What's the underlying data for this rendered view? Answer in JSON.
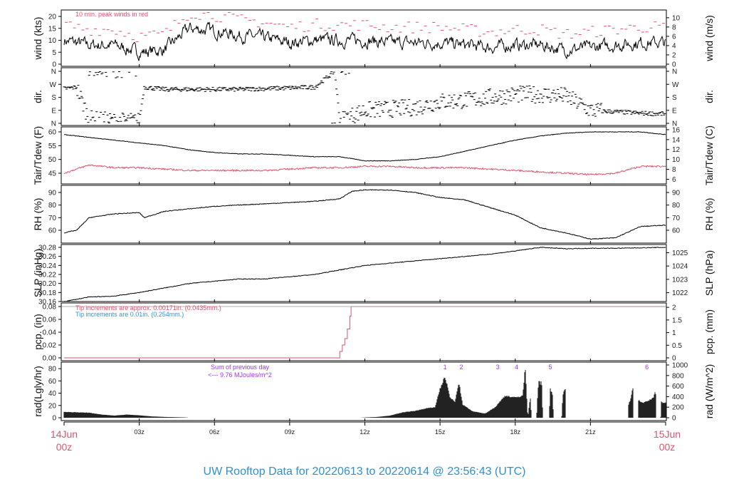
{
  "title": "UW Rooftop Data for 20220613  to  20220614 @ 23:56:43  (UTC)",
  "colors": {
    "red": "#df536b",
    "blue": "#2297e6",
    "purple": "#a033ee",
    "title": "#2d8fd5",
    "line": "#000000"
  },
  "x_axis": {
    "start_label": [
      "14Jun",
      "00z"
    ],
    "end_label": [
      "15Jun",
      "00z"
    ],
    "ticks": [
      {
        "h": 3,
        "label": "03z"
      },
      {
        "h": 6,
        "label": "06z"
      },
      {
        "h": 9,
        "label": "09z"
      },
      {
        "h": 12,
        "label": "12z"
      },
      {
        "h": 15,
        "label": "15z"
      },
      {
        "h": 18,
        "label": "18z"
      },
      {
        "h": 21,
        "label": "21z"
      }
    ]
  },
  "chart_data": [
    {
      "id": "wind",
      "type": "line",
      "ylabel": "wind (kts)",
      "ylabel_right": "wind (m/s)",
      "annotation": "10 min. peak winds in red",
      "left_ticks": [
        "0",
        "5",
        "10",
        "15",
        "20"
      ],
      "right_ticks": [
        "0",
        "2",
        "4",
        "6",
        "8",
        "10"
      ],
      "hours": [
        0,
        1,
        2,
        3,
        4,
        5,
        6,
        7,
        8,
        9,
        10,
        11,
        12,
        13,
        14,
        15,
        16,
        17,
        18,
        19,
        20,
        21,
        22,
        23,
        24
      ],
      "values": [
        10,
        8,
        8,
        5,
        6,
        15,
        14,
        12,
        11,
        9,
        10,
        10,
        10,
        9,
        9,
        9,
        8,
        7,
        8,
        8,
        6,
        7,
        8,
        9,
        9
      ]
    },
    {
      "id": "dir",
      "type": "scatter",
      "ylabel": "dir.",
      "ylabel_right": "dir.",
      "left_ticks": [
        "N",
        "E",
        "S",
        "W",
        "N"
      ],
      "right_ticks": [
        "N",
        "E",
        "S",
        "W",
        "N"
      ],
      "hours": [
        0,
        0.5,
        1,
        2,
        3,
        3.2,
        4,
        5,
        6,
        7,
        8,
        9,
        10,
        10.8,
        11,
        12,
        13,
        14,
        15,
        16,
        17,
        18,
        19,
        20,
        21,
        22,
        23,
        24
      ],
      "values": [
        240,
        250,
        30,
        15,
        15,
        250,
        235,
        235,
        235,
        235,
        240,
        245,
        250,
        360,
        20,
        90,
        100,
        110,
        150,
        160,
        180,
        200,
        200,
        190,
        90,
        80,
        70,
        65
      ]
    },
    {
      "id": "temp",
      "type": "line",
      "ylabel": "Tair/Tdew (F)",
      "ylabel_right": "Tair/Tdew (C)",
      "left_ticks": [
        "45",
        "50",
        "55",
        "60"
      ],
      "right_ticks": [
        "6",
        "8",
        "10",
        "12",
        "14",
        "16"
      ],
      "hours": [
        0,
        1,
        2,
        3,
        4,
        5,
        6,
        7,
        8,
        9,
        10,
        11,
        12,
        13,
        14,
        15,
        16,
        17,
        18,
        19,
        20,
        21,
        22,
        23,
        24
      ],
      "series": [
        {
          "name": "Tair",
          "values": [
            59,
            58,
            57,
            56,
            55,
            53.5,
            52.5,
            52,
            52,
            51.5,
            51,
            51,
            49.5,
            49.5,
            50,
            51,
            53,
            55,
            57,
            58.5,
            59.5,
            60,
            60,
            60,
            59
          ]
        },
        {
          "name": "Tdew",
          "values": [
            45,
            48,
            47,
            47,
            46.5,
            46,
            46,
            46,
            46,
            46.5,
            47,
            47,
            47.5,
            47.5,
            47,
            47,
            47,
            46.5,
            46,
            45.5,
            45,
            44.5,
            45,
            47.5,
            47.5
          ]
        }
      ]
    },
    {
      "id": "rh",
      "type": "line",
      "ylabel": "RH (%)",
      "ylabel_right": "RH (%)",
      "left_ticks": [
        "60",
        "70",
        "80",
        "90"
      ],
      "right_ticks": [
        "60",
        "70",
        "80",
        "90"
      ],
      "hours": [
        0,
        0.5,
        1,
        2,
        3,
        3.2,
        4,
        5,
        6,
        7,
        8,
        9,
        10,
        11,
        11.5,
        12,
        13,
        14,
        15,
        16,
        17,
        18,
        19,
        20,
        21,
        22,
        23,
        24
      ],
      "values": [
        58,
        60,
        70,
        73,
        74,
        70,
        75,
        77,
        79,
        80,
        81,
        82,
        83,
        85,
        91,
        92,
        92,
        90,
        86,
        84,
        78,
        72,
        62,
        58,
        53,
        54,
        63,
        64
      ]
    },
    {
      "id": "slp",
      "type": "line",
      "ylabel": "SLP (inHg)",
      "ylabel_right": "SLP (hPa)",
      "left_ticks": [
        "30.16",
        "30.18",
        "30.20",
        "30.22",
        "30.24",
        "30.26",
        "30.28"
      ],
      "right_ticks": [
        "1022",
        "1023",
        "1024",
        "1025"
      ],
      "hours": [
        0,
        1,
        2,
        3,
        4,
        5,
        6,
        7,
        8,
        9,
        10,
        11,
        12,
        13,
        14,
        15,
        16,
        17,
        18,
        19,
        20,
        21,
        22,
        23,
        24
      ],
      "values": [
        30.16,
        30.17,
        30.172,
        30.18,
        30.19,
        30.2,
        30.205,
        30.21,
        30.21,
        30.215,
        30.22,
        30.23,
        30.24,
        30.245,
        30.25,
        30.255,
        30.26,
        30.265,
        30.272,
        30.28,
        30.277,
        30.278,
        30.278,
        30.279,
        30.28
      ]
    },
    {
      "id": "pcp",
      "type": "line",
      "ylabel": "pcp. (in)",
      "ylabel_right": "pcp. (mm)",
      "note_red": "Tip increments are approx. 0.00171in. (0.0435mm.)",
      "note_blue": "Tip increments are 0.01in. (0.254mm.)",
      "left_ticks": [
        "0.00",
        "0.02",
        "0.04",
        "0.06",
        "0.08"
      ],
      "right_ticks": [
        "0",
        "0.5",
        "1",
        "1.5",
        "2"
      ],
      "hours": [
        0,
        10.9,
        11.0,
        11.1,
        11.2,
        11.3,
        11.4,
        11.45,
        24
      ],
      "values": [
        0,
        0,
        0.01,
        0.02,
        0.03,
        0.045,
        0.065,
        0.08,
        0.08
      ]
    },
    {
      "id": "rad",
      "type": "area",
      "ylabel": "rad(Lgly/hr)",
      "ylabel_right": "rad (W/m^2)",
      "note": "Sum of previous day",
      "note2": "<--- 9.76 MJoules/m^2",
      "left_ticks": [
        "0",
        "20",
        "40",
        "60",
        "80"
      ],
      "right_ticks": [
        "0",
        "200",
        "400",
        "600",
        "800",
        "1000"
      ],
      "markers": [
        {
          "h": 15.2,
          "label": "1"
        },
        {
          "h": 15.85,
          "label": "2"
        },
        {
          "h": 17.3,
          "label": "3"
        },
        {
          "h": 18.05,
          "label": "4"
        },
        {
          "h": 19.4,
          "label": "5"
        },
        {
          "h": 23.25,
          "label": "6"
        }
      ],
      "points": [
        [
          0,
          110
        ],
        [
          1,
          95
        ],
        [
          1.5,
          60
        ],
        [
          2,
          40
        ],
        [
          2.5,
          60
        ],
        [
          3,
          45
        ],
        [
          3.5,
          25
        ],
        [
          4,
          15
        ],
        [
          4.5,
          10
        ],
        [
          4.9,
          5
        ],
        [
          4.95,
          0
        ],
        [
          11.8,
          0
        ],
        [
          12,
          5
        ],
        [
          12.5,
          15
        ],
        [
          13,
          40
        ],
        [
          13.5,
          100
        ],
        [
          14,
          130
        ],
        [
          14.5,
          180
        ],
        [
          14.8,
          200
        ],
        [
          15.0,
          550
        ],
        [
          15.2,
          780
        ],
        [
          15.4,
          380
        ],
        [
          15.6,
          300
        ],
        [
          15.75,
          680
        ],
        [
          15.9,
          250
        ],
        [
          16.3,
          120
        ],
        [
          16.8,
          80
        ],
        [
          17.2,
          200
        ],
        [
          17.6,
          420
        ],
        [
          18,
          380
        ],
        [
          18.3,
          420
        ],
        [
          18.4,
          960
        ],
        [
          18.5,
          0
        ],
        [
          18.6,
          400
        ],
        [
          18.65,
          0
        ],
        [
          18.85,
          0
        ],
        [
          18.9,
          500
        ],
        [
          18.95,
          750
        ],
        [
          19.0,
          600
        ],
        [
          19.05,
          720
        ],
        [
          19.1,
          0
        ],
        [
          19.35,
          0
        ],
        [
          19.4,
          550
        ],
        [
          19.5,
          420
        ],
        [
          19.52,
          0
        ],
        [
          19.85,
          0
        ],
        [
          19.9,
          450
        ],
        [
          20.0,
          560
        ],
        [
          20.02,
          0
        ],
        [
          22.5,
          0
        ],
        [
          22.52,
          250
        ],
        [
          22.6,
          350
        ],
        [
          22.7,
          580
        ],
        [
          22.72,
          0
        ],
        [
          22.9,
          0
        ],
        [
          22.92,
          330
        ],
        [
          23.1,
          280
        ],
        [
          23.3,
          330
        ],
        [
          23.5,
          370
        ],
        [
          23.6,
          500
        ],
        [
          23.62,
          0
        ],
        [
          23.8,
          0
        ],
        [
          23.82,
          300
        ],
        [
          24,
          280
        ]
      ]
    }
  ]
}
